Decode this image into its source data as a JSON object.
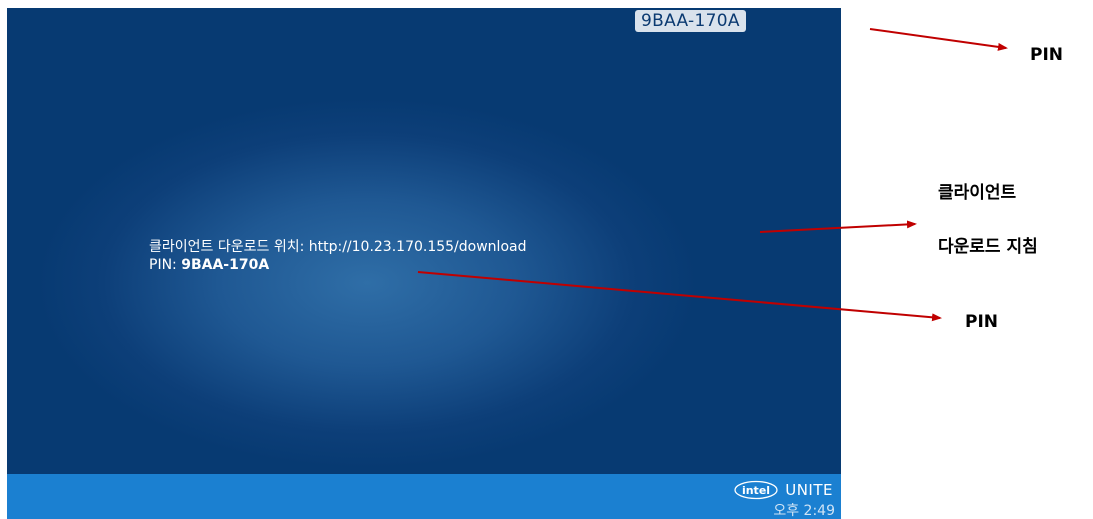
{
  "screen": {
    "pin_badge": "9BAA-170A",
    "instructions": {
      "download_label": "클라이언트 다운로드 위치: http://10.23.170.155/download",
      "pin_label": "PIN: ",
      "pin_value": "9BAA-170A"
    },
    "taskbar": {
      "brand_logo_text": "intel",
      "brand_name": "UNITE",
      "clock": "오후 2:49"
    }
  },
  "annotations": {
    "top_pin": "PIN",
    "client_line1": "클라이언트",
    "client_line2": "다운로드 지침",
    "mid_pin": "PIN"
  },
  "colors": {
    "screen_background": "#0d3f79",
    "taskbar": "#1b80d1",
    "arrow": "#c00000"
  }
}
